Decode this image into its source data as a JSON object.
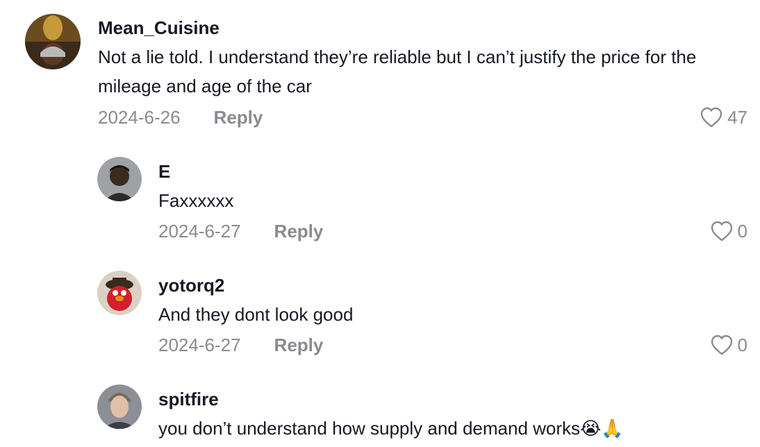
{
  "comments": [
    {
      "username": "Mean_Cuisine",
      "text": "Not a lie told. I understand they’re reliable but I can’t justify the price for the mileage and age of the car",
      "date": "2024-6-26",
      "reply_label": "Reply",
      "likes": "47"
    },
    {
      "username": "E",
      "text": "Faxxxxxx",
      "date": "2024-6-27",
      "reply_label": "Reply",
      "likes": "0"
    },
    {
      "username": "yotorq2",
      "text": "And they dont look good",
      "date": "2024-6-27",
      "reply_label": "Reply",
      "likes": "0"
    },
    {
      "username": "spitfire",
      "text": "you don’t understand how supply and demand works😭🙏"
    }
  ],
  "icons": {
    "like": "heart-outline-icon",
    "avatar": "user-avatar"
  },
  "colors": {
    "text": "#161823",
    "secondary": "#8a8b91",
    "background": "#ffffff"
  }
}
